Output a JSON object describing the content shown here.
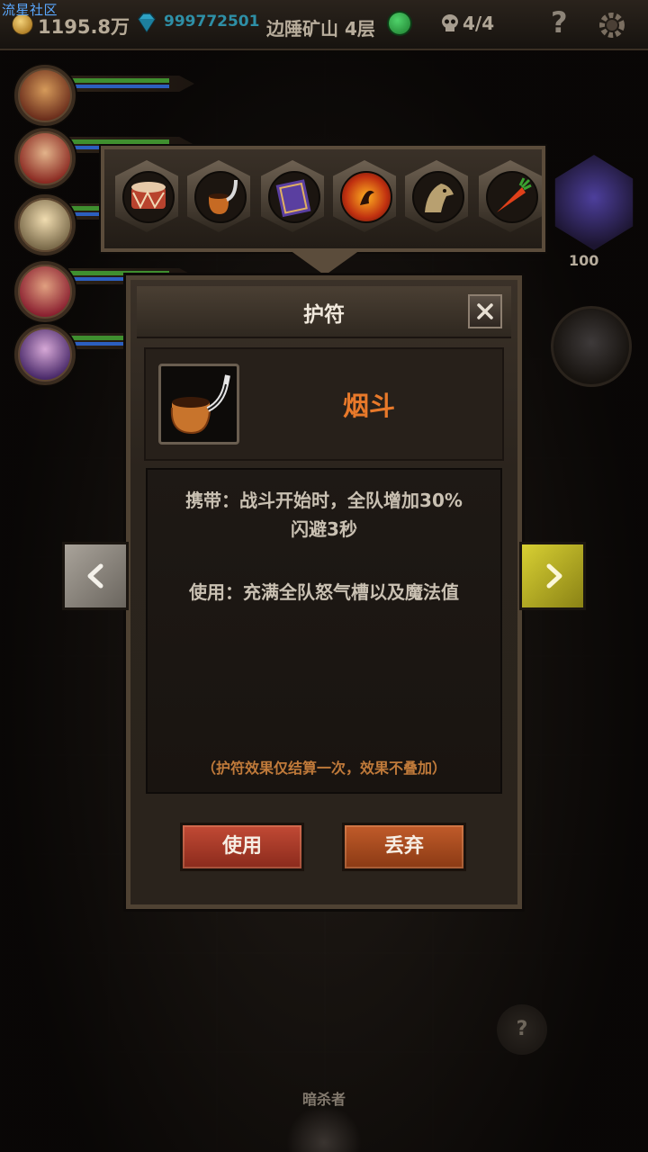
{
  "watermark": "流星社区",
  "topbar": {
    "gold": "1195.8万",
    "gems": "999772501",
    "location": "边陲矿山 4层",
    "kills": "4/4",
    "help_glyph": "?"
  },
  "heroes": [
    {
      "name": "hero-1"
    },
    {
      "name": "hero-2"
    },
    {
      "name": "hero-3"
    },
    {
      "name": "hero-4"
    },
    {
      "name": "hero-5"
    }
  ],
  "side": {
    "angel_count": "100"
  },
  "amulets": [
    {
      "icon": "drum-icon"
    },
    {
      "icon": "pipe-icon"
    },
    {
      "icon": "book-icon"
    },
    {
      "icon": "fire-orb-icon"
    },
    {
      "icon": "gryphon-icon"
    },
    {
      "icon": "carrot-icon"
    }
  ],
  "modal": {
    "title": "护符",
    "item_name": "烟斗",
    "carry_effect_line1": "携带：战斗开始时，全队增加30%",
    "carry_effect_line2": "闪避3秒",
    "use_effect": "使用：充满全队怒气槽以及魔法值",
    "note": "（护符效果仅结算一次，效果不叠加）",
    "use_button": "使用",
    "discard_button": "丢弃"
  },
  "bottom": {
    "help_glyph": "?",
    "enemy_label": "暗杀者"
  },
  "colors": {
    "item_name": "#e8792a",
    "note": "#c07a3a",
    "use_button": "#c24a35",
    "discard_button": "#c15b2a",
    "next_arrow": "#d8d033",
    "prev_arrow": "#a9a39a"
  }
}
